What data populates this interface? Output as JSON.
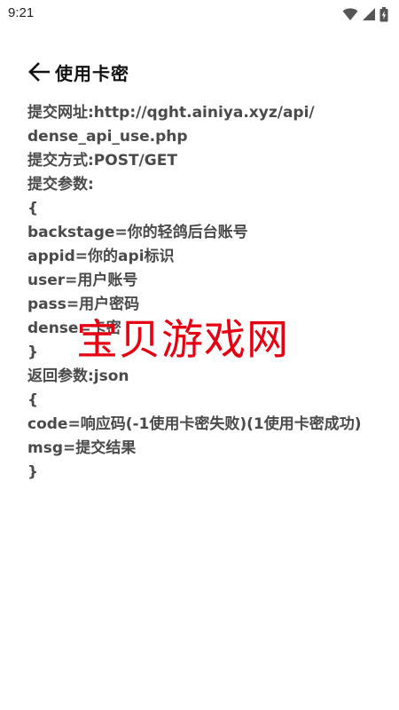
{
  "status_bar": {
    "time": "9:21",
    "icons": [
      "wifi-icon",
      "signal-icon",
      "battery-icon"
    ]
  },
  "header": {
    "back_icon": "arrow-left-icon",
    "title": "使用卡密"
  },
  "content": {
    "lines": [
      "提交网址:http://qght.ainiya.xyz/api/",
      "dense_api_use.php",
      "提交方式:POST/GET",
      "提交参数:",
      "{",
      "backstage=你的轻鸽后台账号",
      "appid=你的api标识",
      "user=用户账号",
      "pass=用户密码",
      "dense=卡密",
      "}",
      "返回参数:json",
      "{",
      "code=响应码(-1使用卡密失败)(1使用卡密成功)",
      "msg=提交结果",
      "}"
    ]
  },
  "watermark": {
    "text": "宝贝游戏网",
    "color": "#e60012"
  },
  "colors": {
    "text": "#4a4a4a",
    "title": "#111111",
    "background": "#ffffff"
  }
}
